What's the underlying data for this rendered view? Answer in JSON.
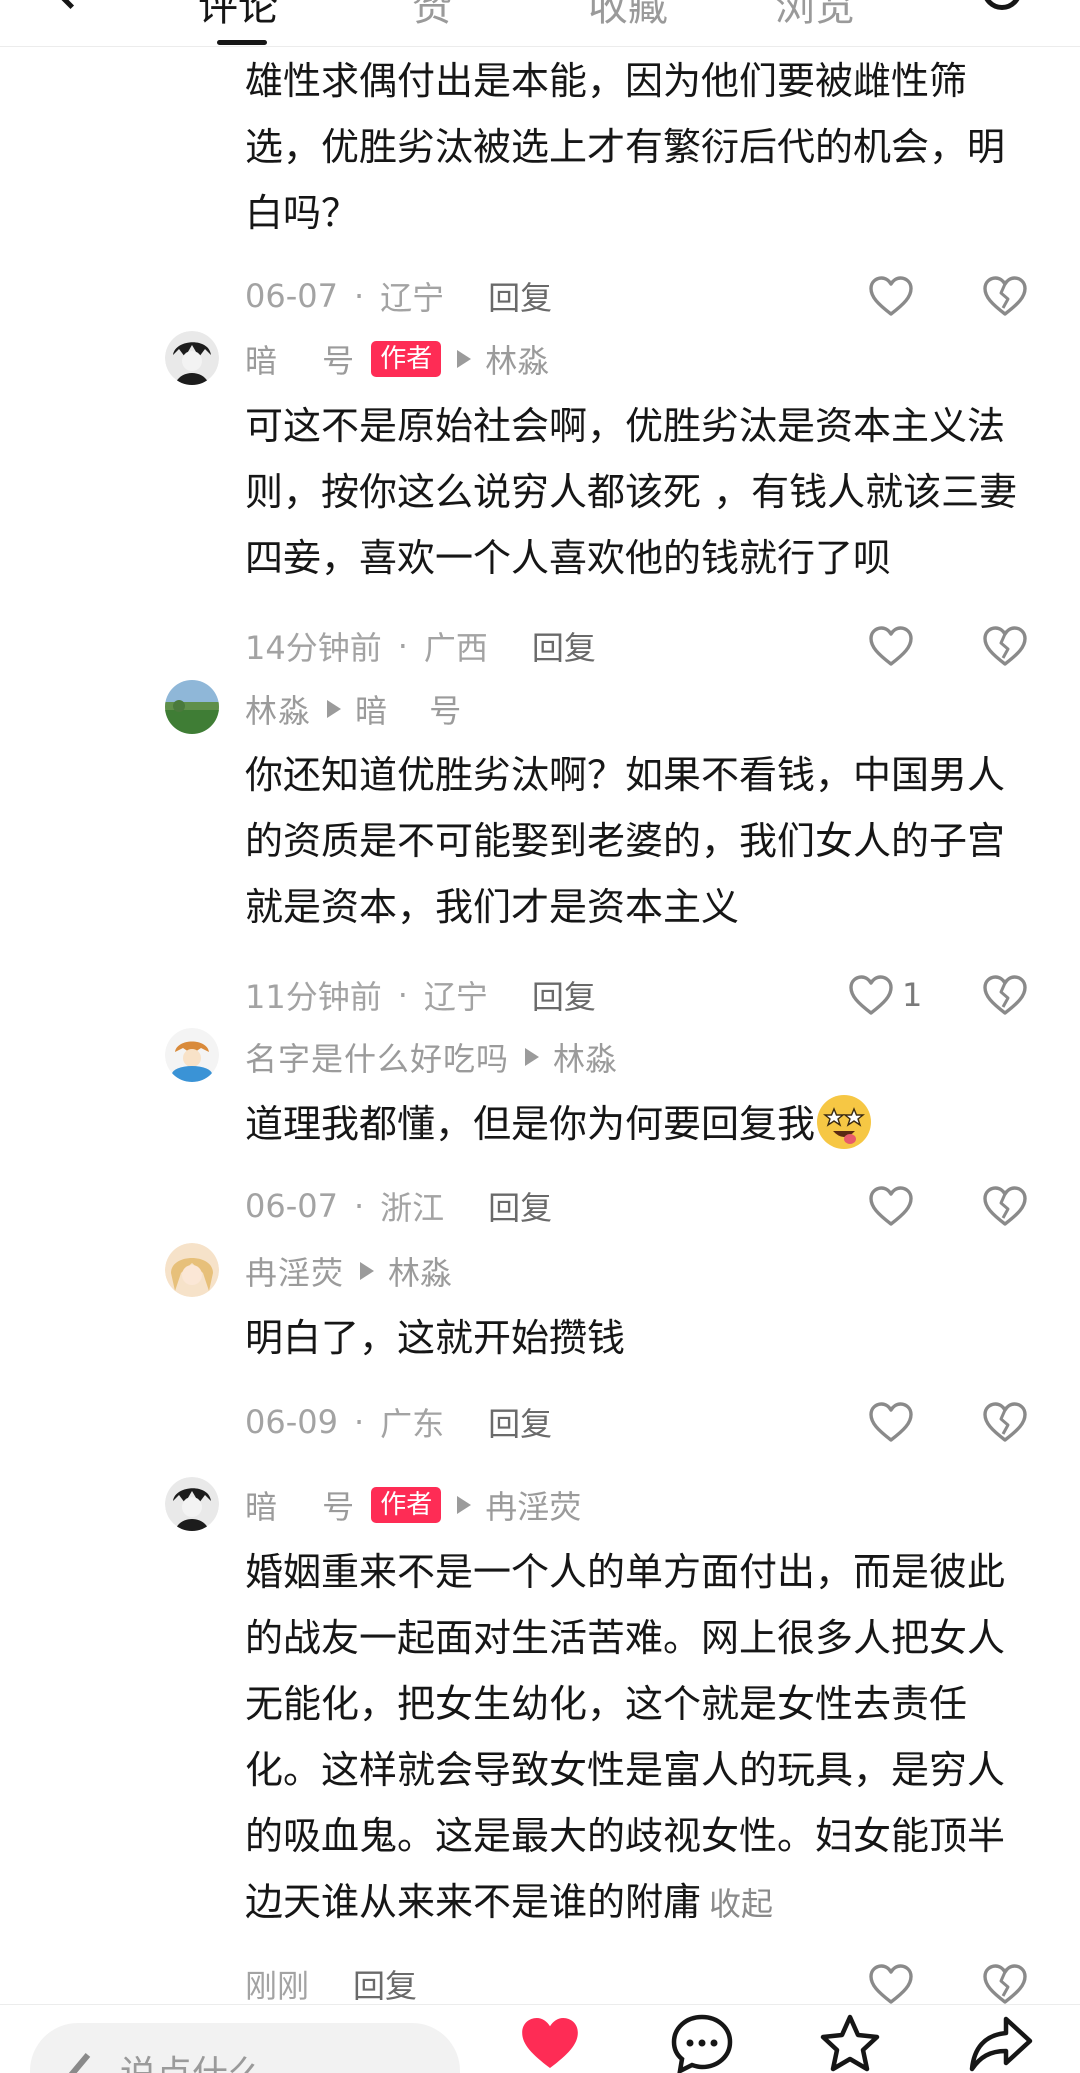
{
  "top_tabs": [
    "评论",
    "赞",
    "收藏",
    "浏览"
  ],
  "comments": [
    {
      "body": "雄性求偶付出是本能，因为他们要被雌性筛选，优胜劣汰被选上才有繁衍后代的机会，明白吗？",
      "time": "06-07",
      "location": "辽宁",
      "reply": "回复",
      "likes": ""
    },
    {
      "name": "暗　 号",
      "badge": "作者",
      "reply_to": "林淼",
      "body": "可这不是原始社会啊，优胜劣汰是资本主义法则，按你这么说穷人都该死 ，有钱人就该三妻四妾，喜欢一个人喜欢他的钱就行了呗",
      "time": "14分钟前",
      "location": "广西",
      "reply": "回复",
      "likes": ""
    },
    {
      "name": "林淼",
      "reply_to": "暗　 号",
      "body": "你还知道优胜劣汰啊？如果不看钱，中国男人的资质是不可能娶到老婆的，我们女人的子宫就是资本，我们才是资本主义",
      "time": "11分钟前",
      "location": "辽宁",
      "reply": "回复",
      "likes": "1"
    },
    {
      "name": "名字是什么好吃吗",
      "reply_to": "林淼",
      "body": "道理我都懂，但是你为何要回复我",
      "time": "06-07",
      "location": "浙江",
      "reply": "回复",
      "likes": ""
    },
    {
      "name": "冉淫荧",
      "reply_to": "林淼",
      "body": "明白了，这就开始攒钱",
      "time": "06-09",
      "location": "广东",
      "reply": "回复",
      "likes": ""
    },
    {
      "name": "暗　 号",
      "badge": "作者",
      "reply_to": "冉淫荧",
      "body": "婚姻重来不是一个人的单方面付出，而是彼此的战友一起面对生活苦难。网上很多人把女人无能化，把女生幼化，这个就是女性去责任化。这样就会导致女性是富人的玩具，是穷人的吸血鬼。这是最大的歧视女性。妇女能顶半边天谁从来来不是谁的附庸",
      "collapse": "收起",
      "time": "刚刚",
      "reply": "回复",
      "likes": ""
    }
  ],
  "bottom": {
    "placeholder": "说点什么..."
  },
  "colors": {
    "accent": "#fe2c55",
    "secondary_text": "#9b9b9b"
  },
  "icons": [
    "heart-outline-icon",
    "broken-heart-icon",
    "heart-filled-icon",
    "comment-bubble-icon",
    "star-icon",
    "share-icon",
    "pencil-icon"
  ]
}
